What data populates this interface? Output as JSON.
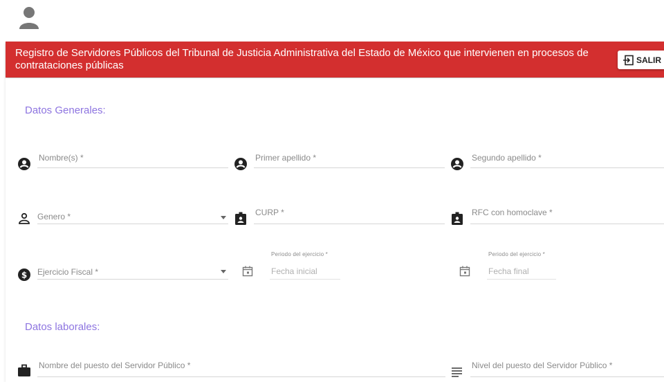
{
  "header": {
    "title": "Registro de Servidores Públicos del Tribunal de Justicia Administrativa del Estado de México que intervienen en procesos de contrataciones públicas",
    "logout_label": "SALIR"
  },
  "sections": {
    "general": "Datos Generales:",
    "laboral": "Datos laborales:"
  },
  "fields": {
    "nombre": "Nombre(s) *",
    "primer_apellido": "Primer apellido *",
    "segundo_apellido": "Segundo apellido *",
    "genero": "Genero *",
    "curp": "CURP *",
    "rfc": "RFC con homoclave *",
    "ejercicio_fiscal": "Ejercicio Fiscal *",
    "periodo_label_1": "Periodo del ejercicio *",
    "fecha_inicial": "Fecha inicial",
    "periodo_label_2": "Periodo del ejercicio *",
    "fecha_final": "Fecha final",
    "puesto": "Nombre del puesto del Servidor Público *",
    "nivel_puesto": "Nivel del puesto del Servidor Público *"
  },
  "colors": {
    "header": "#d32f2f",
    "section": "#8d74e0"
  }
}
